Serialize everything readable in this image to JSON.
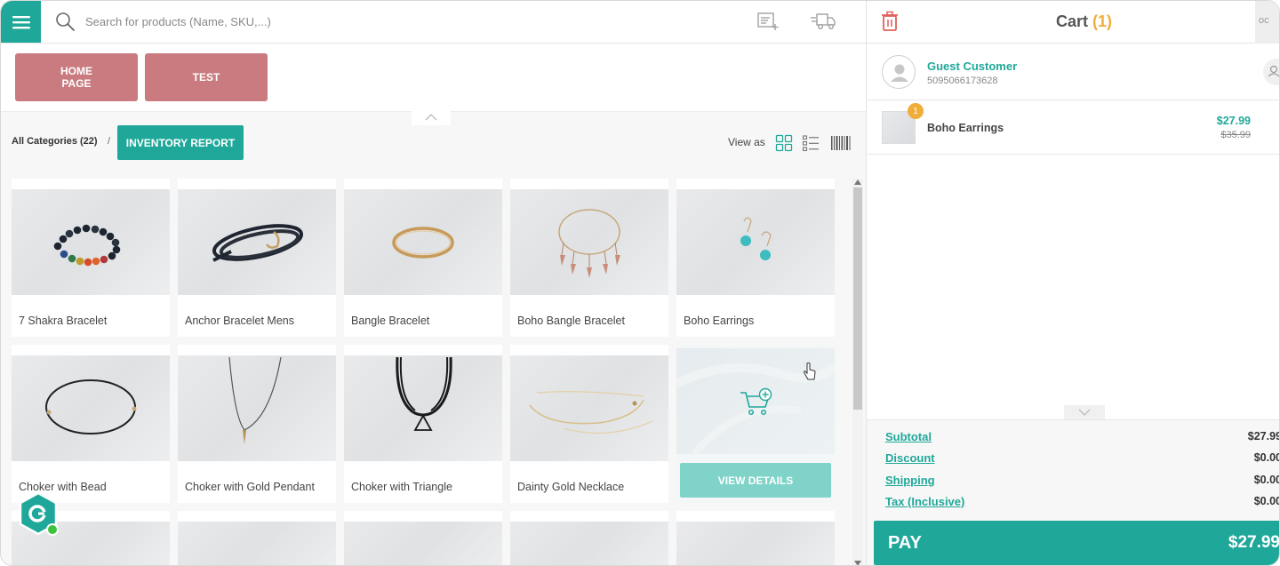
{
  "search": {
    "placeholder": "Search for products (Name, SKU,...)"
  },
  "quick_buttons": [
    {
      "label": "HOME PAGE"
    },
    {
      "label": "TEST"
    }
  ],
  "category_bar": {
    "breadcrumb": "All Categories (22)",
    "separator": "/",
    "inventory_button": "INVENTORY REPORT",
    "view_as_label": "View as"
  },
  "products": [
    {
      "name": "7 Shakra Bracelet"
    },
    {
      "name": "Anchor Bracelet Mens"
    },
    {
      "name": "Bangle Bracelet"
    },
    {
      "name": "Boho Bangle Bracelet"
    },
    {
      "name": "Boho Earrings"
    },
    {
      "name": "Choker with Bead"
    },
    {
      "name": "Choker with Gold Pendant"
    },
    {
      "name": "Choker with Triangle"
    },
    {
      "name": "Dainty Gold Necklace"
    },
    {
      "name": ""
    }
  ],
  "hover_card": {
    "view_details": "VIEW DETAILS"
  },
  "cart": {
    "title": "Cart",
    "count": "(1)",
    "header_right_text": "oc",
    "customer": {
      "name": "Guest Customer",
      "phone": "5095066173628"
    },
    "items": [
      {
        "name": "Boho Earrings",
        "quantity": "1",
        "price": "$27.99",
        "original_price": "$35.99"
      }
    ],
    "totals": {
      "subtotal_label": "Subtotal",
      "subtotal": "$27.99",
      "discount_label": "Discount",
      "discount": "$0.00",
      "shipping_label": "Shipping",
      "shipping": "$0.00",
      "tax_label": "Tax (Inclusive)",
      "tax": "$0.00"
    },
    "pay_label": "PAY",
    "pay_amount": "$27.99"
  },
  "colors": {
    "accent": "#1fa89a",
    "quick_button": "#c97b7f",
    "badge": "#f0ad3a",
    "delete": "#e0605a"
  },
  "icons": {
    "menu": "hamburger-icon",
    "search": "search-icon",
    "custom_sale": "receipt-add-icon",
    "shipping": "truck-icon",
    "trash": "trash-icon",
    "grid_view": "grid-view-icon",
    "list_view": "list-view-icon",
    "barcode": "barcode-icon",
    "add_to_cart": "cart-plus-icon"
  }
}
